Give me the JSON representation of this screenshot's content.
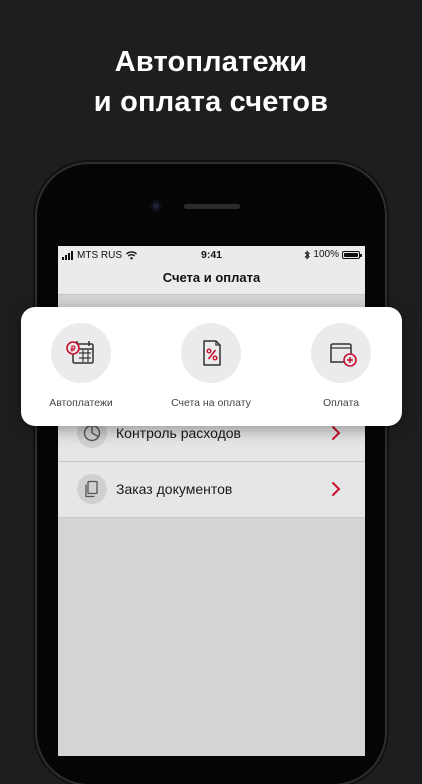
{
  "promo": {
    "title_line1": "Автоплатежи",
    "title_line2": "и оплата счетов"
  },
  "status_bar": {
    "carrier": "MTS RUS",
    "time": "9:41",
    "battery": "100%"
  },
  "nav": {
    "title": "Счета и оплата"
  },
  "card": {
    "items": [
      {
        "label": "Автоплатежи",
        "icon": "autopay-calendar-icon"
      },
      {
        "label": "Счета на оплату",
        "icon": "invoice-percent-icon"
      },
      {
        "label": "Оплата",
        "icon": "wallet-plus-icon"
      }
    ]
  },
  "list": {
    "items": [
      {
        "label": "Контроль расходов",
        "icon": "pie-chart-icon"
      },
      {
        "label": "Заказ документов",
        "icon": "documents-icon"
      }
    ]
  },
  "colors": {
    "accent": "#c8102e",
    "background": "#1e1e20"
  }
}
